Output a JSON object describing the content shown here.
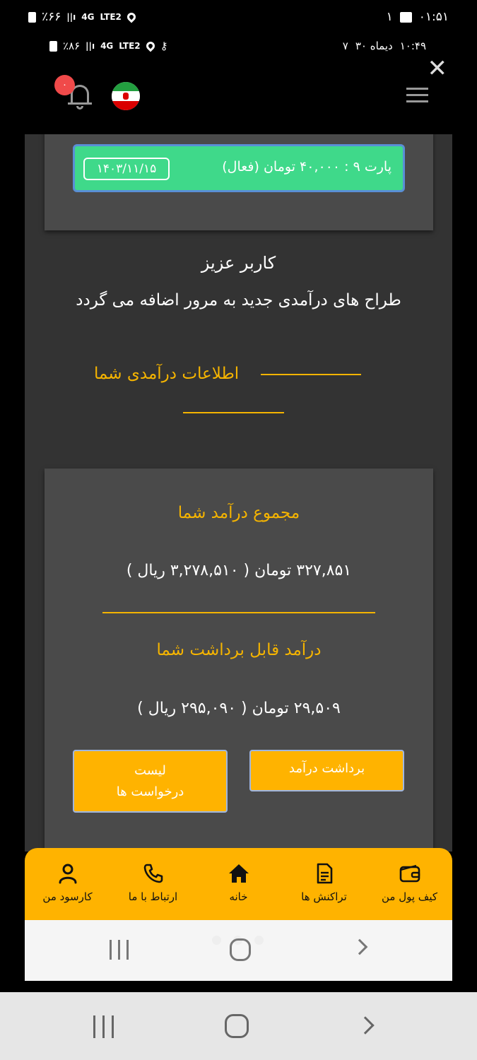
{
  "status_bar_outer": {
    "battery": "٪۶۶",
    "network": "4G",
    "lte": "LTE2",
    "notif_count": "۱",
    "time": "۰۱:۵۱"
  },
  "status_bar_inner": {
    "battery": "٪۸۶",
    "network": "4G",
    "lte": "LTE2",
    "date": "۳۰ دیماه",
    "day_mark": "۷",
    "time": "۱۰:۴۹"
  },
  "header": {
    "notification_badge": "۰"
  },
  "installment": {
    "label": "پارت ۹ : ۴۰,۰۰۰ تومان (فعال)",
    "date": "۱۴۰۳/۱۱/۱۵"
  },
  "message": {
    "greeting": "کاربر عزیز",
    "text": "طراح های درآمدی جدید به مرور اضافه می گردد"
  },
  "section": {
    "title": "اطلاعات درآمدی شما"
  },
  "income": {
    "total_label": "مجموع درآمد شما",
    "total_value": "۳۲۷,۸۵۱ تومان ( ۳,۲۷۸,۵۱۰ ریال )",
    "withdrawable_label": "درآمد قابل برداشت شما",
    "withdrawable_value": "۲۹,۵۰۹ تومان ( ۲۹۵,۰۹۰ ریال )",
    "withdraw_button": "برداشت درآمد",
    "requests_button_line1": "لیست",
    "requests_button_line2": "درخواست ها"
  },
  "bottom_nav": {
    "wallet": "کیف پول من",
    "transactions": "تراکنش ها",
    "home": "خانه",
    "contact": "ارتباط با ما",
    "profile": "کارسود من"
  },
  "colors": {
    "accent": "#ffb300",
    "active_installment": "#3fd98a",
    "panel": "#4a4a4a",
    "background": "#333333"
  }
}
